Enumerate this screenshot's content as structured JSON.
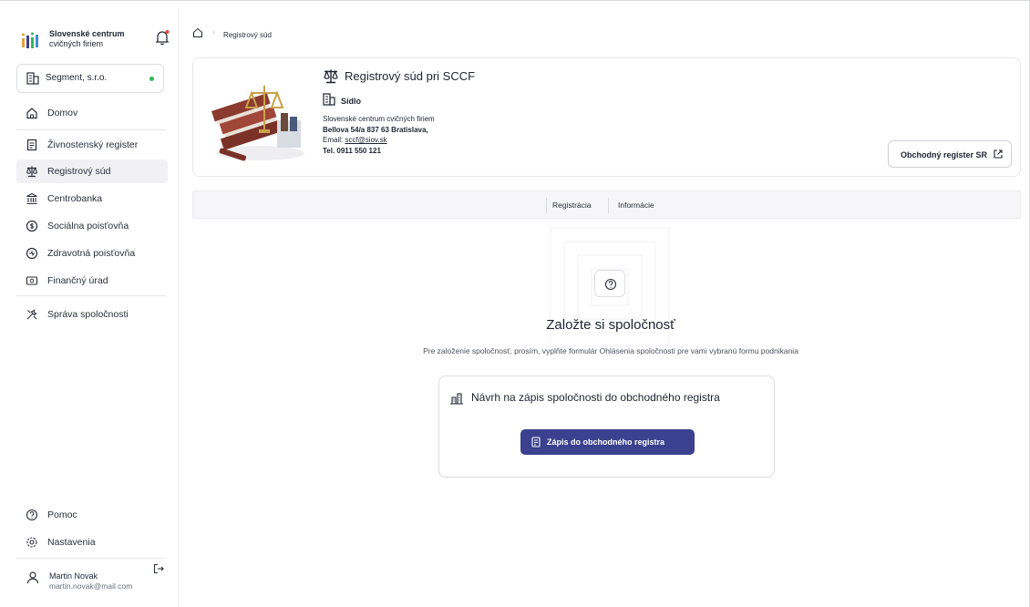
{
  "brand": {
    "line1": "Slovenské centrum",
    "line2": "cvičných firiem"
  },
  "company": {
    "name": "Segment, s.r.o."
  },
  "nav": {
    "items": [
      {
        "label": "Domov",
        "icon": "home-icon"
      },
      {
        "label": "Živnostenský register",
        "icon": "document-icon"
      },
      {
        "label": "Registrový súd",
        "icon": "scales-icon"
      },
      {
        "label": "Centrobanka",
        "icon": "bank-icon"
      },
      {
        "label": "Sociálna poisťovňa",
        "icon": "shield-icon"
      },
      {
        "label": "Zdravotná poisťovňa",
        "icon": "health-icon"
      },
      {
        "label": "Finančný úrad",
        "icon": "finance-icon"
      },
      {
        "label": "Správa spoločnosti",
        "icon": "tools-icon"
      }
    ],
    "bottom": [
      {
        "label": "Pomoc",
        "icon": "help-icon"
      },
      {
        "label": "Nastavenia",
        "icon": "settings-icon"
      }
    ]
  },
  "user": {
    "name": "Martin Novak",
    "email": "martin.novak@mail.com"
  },
  "breadcrumb": {
    "current": "Registrový súd"
  },
  "court": {
    "title": "Registrový súd pri SCCF",
    "seat_label": "Sídlo",
    "org": "Slovenské centrum cvičných firiem",
    "street": "Bellova 54/a 837 63 Bratislava,",
    "email_prefix": "Email: ",
    "email": "sccf@siov.sk",
    "phone": "Tel. 0911 550 121",
    "ext_button": "Obchodný register SR"
  },
  "tabs": [
    {
      "label": "Registrácia"
    },
    {
      "label": "Informácie"
    }
  ],
  "empty_state": {
    "title": "Založte si spoločnosť",
    "subtitle": "Pre založenie spoločnosť, prosím, vyplňte formulár Ohlásenia spoločnosti pre vami vybranú formu podnikania",
    "panel_title": "Návrh na zápis spoločnosti do obchodného registra",
    "cta": "Zápis do obchodného registra"
  },
  "colors": {
    "accent": "#3b418e",
    "status_online": "#33b55b",
    "active_bg": "#f1f1f4"
  }
}
